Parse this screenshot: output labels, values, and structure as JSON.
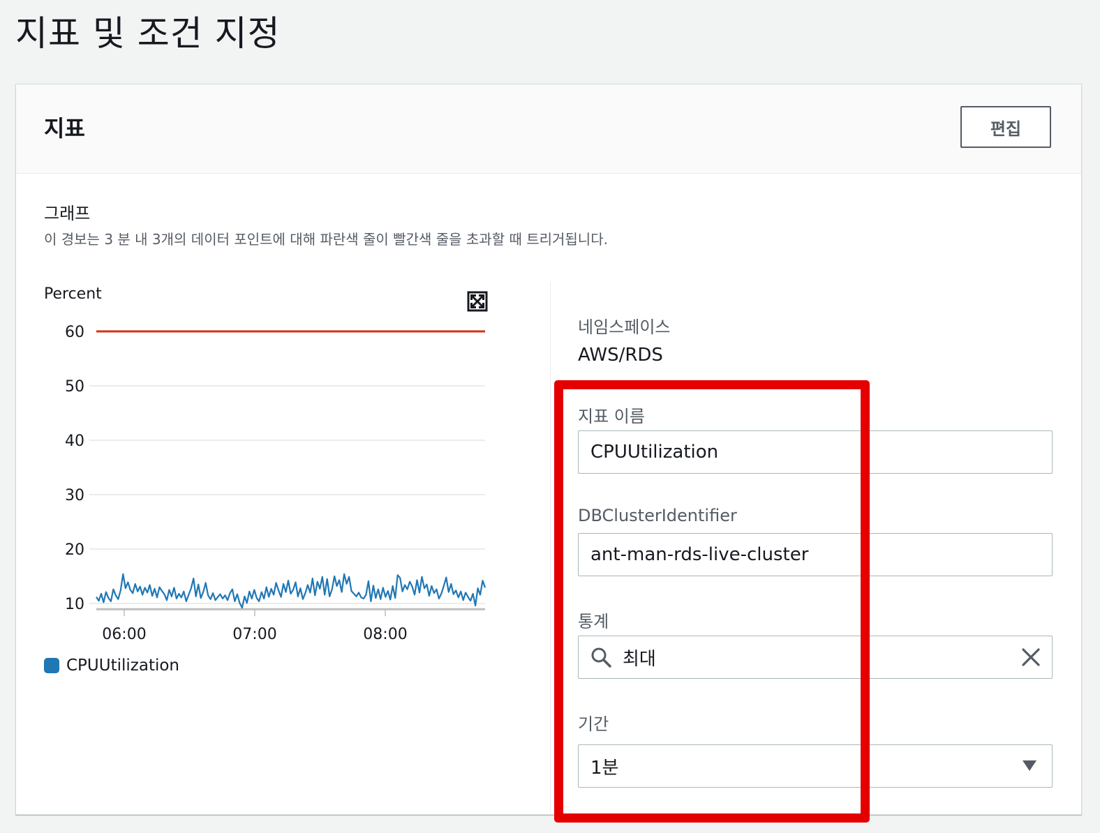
{
  "page": {
    "title": "지표 및 조건 지정"
  },
  "panel": {
    "title": "지표",
    "edit_label": "편집",
    "graph": {
      "label": "그래프",
      "description": "이 경보는 3 분 내 3개의 데이터 포인트에 대해 파란색 줄이 빨간색 줄을 초과할 때 트리거됩니다."
    }
  },
  "chart_data": {
    "type": "line",
    "ylabel": "Percent",
    "ylim": [
      9,
      62
    ],
    "yticks": [
      "60",
      "50",
      "40",
      "30",
      "20",
      "10"
    ],
    "xticks": [
      "06:00",
      "07:00",
      "08:00"
    ],
    "threshold": {
      "value": 60,
      "color": "#d13212"
    },
    "series": [
      {
        "name": "CPUUtilization",
        "color": "#1f77b4",
        "values": [
          11.2,
          10.5,
          11.8,
          10.2,
          12.1,
          11.0,
          10.4,
          12.6,
          11.5,
          10.8,
          12.4,
          15.4,
          12.8,
          13.9,
          12.5,
          11.9,
          13.6,
          12.2,
          13.1,
          11.6,
          12.9,
          12.0,
          13.4,
          11.4,
          12.7,
          11.1,
          13.0,
          12.3,
          11.7,
          10.6,
          12.5,
          11.3,
          12.9,
          10.9,
          11.8,
          11.1,
          12.2,
          10.4,
          11.6,
          12.8,
          14.6,
          11.3,
          13.5,
          11.0,
          12.1,
          13.8,
          11.5,
          10.8,
          11.9,
          10.6,
          11.2,
          11.7,
          10.9,
          11.5,
          10.6,
          11.9,
          12.6,
          10.4,
          11.7,
          10.1,
          9.2,
          11.3,
          10.1,
          12.2,
          10.9,
          12.5,
          11.0,
          10.4,
          12.1,
          10.9,
          13.0,
          11.2,
          12.7,
          11.6,
          13.8,
          12.4,
          11.2,
          13.6,
          12.1,
          14.2,
          11.8,
          12.5,
          13.9,
          11.3,
          12.8,
          10.8,
          11.9,
          13.4,
          12.0,
          14.6,
          11.5,
          14.0,
          12.7,
          14.9,
          11.6,
          14.5,
          11.3,
          12.6,
          15.0,
          13.2,
          14.3,
          12.1,
          15.4,
          13.6,
          14.9,
          12.3,
          11.8,
          11.3,
          12.0,
          11.1,
          10.9,
          11.6,
          14.1,
          10.4,
          13.3,
          11.0,
          12.6,
          10.8,
          12.9,
          11.2,
          12.3,
          10.7,
          13.2,
          11.0,
          15.2,
          14.7,
          12.2,
          13.4,
          12.6,
          14.0,
          13.1,
          11.6,
          14.3,
          12.0,
          14.9,
          12.8,
          13.5,
          11.4,
          13.2,
          11.9,
          12.6,
          10.9,
          11.8,
          13.2,
          14.8,
          12.1,
          13.6,
          11.7,
          12.4,
          11.1,
          12.2,
          10.6,
          12.0,
          11.2,
          10.5,
          11.8,
          9.6,
          12.8,
          11.6,
          14.2,
          12.9
        ]
      }
    ]
  },
  "namespace": {
    "label": "네임스페이스",
    "value": "AWS/RDS"
  },
  "fields": {
    "metric_name": {
      "label": "지표 이름",
      "value": "CPUUtilization"
    },
    "cluster": {
      "label": "DBClusterIdentifier",
      "value": "ant-man-rds-live-cluster"
    },
    "statistic": {
      "label": "통계",
      "value": "최대",
      "icon": "search-icon",
      "clear_icon": "close-icon"
    },
    "period": {
      "label": "기간",
      "value": "1분",
      "icon": "caret-down-icon"
    }
  },
  "highlight": {
    "color": "#e40000"
  }
}
